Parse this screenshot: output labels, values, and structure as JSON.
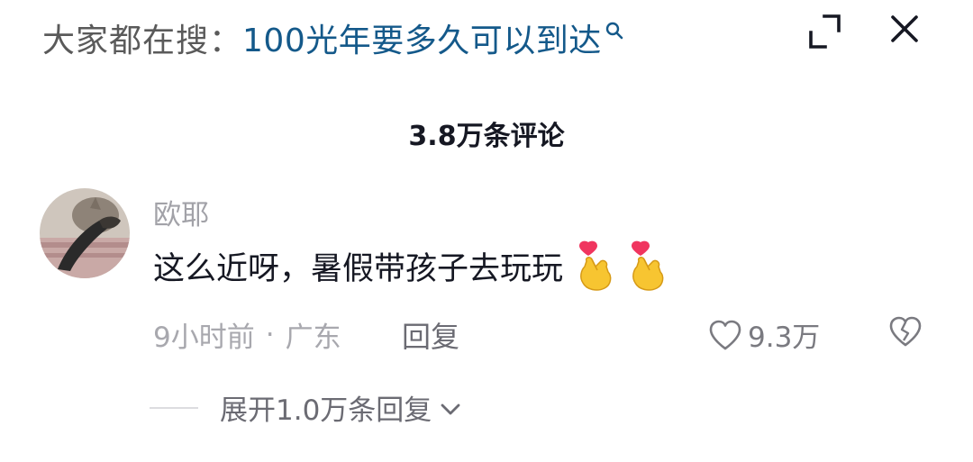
{
  "header": {
    "search_prefix": "大家都在搜：",
    "search_query": "100光年要多久可以到达"
  },
  "comments": {
    "count_label": "3.8万条评论"
  },
  "comment": {
    "author": "欧耶",
    "text": "这么近呀，暑假带孩子去玩玩",
    "time": "9小时前",
    "separator": "·",
    "location": "广东",
    "reply_label": "回复",
    "like_count": "9.3万",
    "expand_replies_label": "展开1.0万条回复"
  },
  "icons": {
    "search": "search-icon",
    "expand": "expand-icon",
    "close": "close-icon",
    "like": "heart-icon",
    "dislike": "broken-heart-icon",
    "chevron": "chevron-down-icon",
    "emoji": "finger-heart-emoji"
  },
  "colors": {
    "search_link": "#14598a",
    "text_primary": "#161823",
    "text_secondary": "#a8a8ae"
  }
}
